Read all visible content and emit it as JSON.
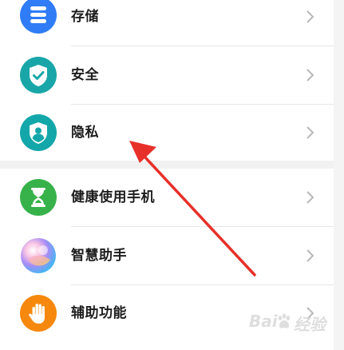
{
  "settings": {
    "items": [
      {
        "label": "存储",
        "icon": "storage-icon",
        "color": "#2f7cf6"
      },
      {
        "label": "安全",
        "icon": "shield-check-icon",
        "color": "#19a6a8"
      },
      {
        "label": "隐私",
        "icon": "privacy-icon",
        "color": "#13a7aa"
      },
      {
        "label": "健康使用手机",
        "icon": "hourglass-icon",
        "color": "#37b24a"
      },
      {
        "label": "智慧助手",
        "icon": "assistant-orb-icon",
        "color": "#9b7bf5"
      },
      {
        "label": "辅助功能",
        "icon": "hand-icon",
        "color": "#f5880d"
      }
    ]
  },
  "annotation": {
    "type": "arrow",
    "color": "#e7302a",
    "points_to": "隐私"
  },
  "watermark": {
    "brand": "Bai",
    "suffix": "经验"
  }
}
